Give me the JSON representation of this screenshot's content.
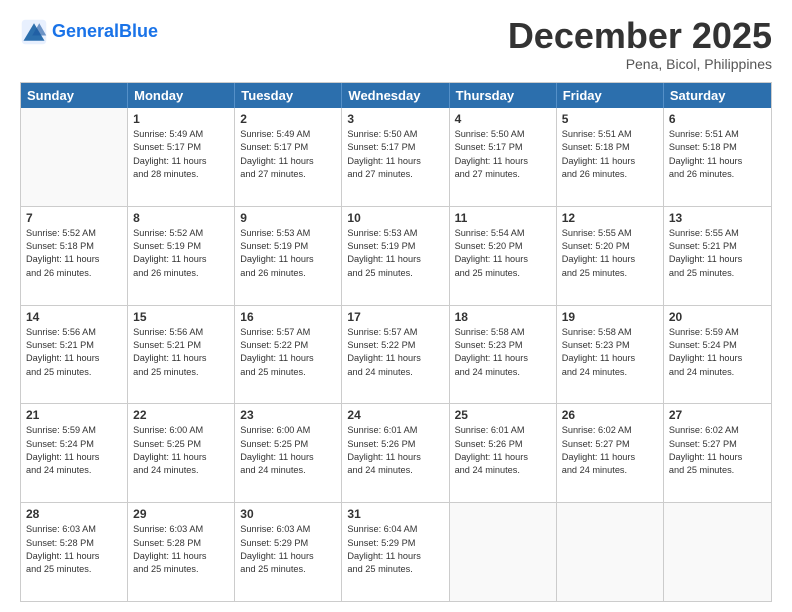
{
  "header": {
    "logo_general": "General",
    "logo_blue": "Blue",
    "month_title": "December 2025",
    "location": "Pena, Bicol, Philippines"
  },
  "day_headers": [
    "Sunday",
    "Monday",
    "Tuesday",
    "Wednesday",
    "Thursday",
    "Friday",
    "Saturday"
  ],
  "weeks": [
    [
      {
        "num": "",
        "info": ""
      },
      {
        "num": "1",
        "info": "Sunrise: 5:49 AM\nSunset: 5:17 PM\nDaylight: 11 hours\nand 28 minutes."
      },
      {
        "num": "2",
        "info": "Sunrise: 5:49 AM\nSunset: 5:17 PM\nDaylight: 11 hours\nand 27 minutes."
      },
      {
        "num": "3",
        "info": "Sunrise: 5:50 AM\nSunset: 5:17 PM\nDaylight: 11 hours\nand 27 minutes."
      },
      {
        "num": "4",
        "info": "Sunrise: 5:50 AM\nSunset: 5:17 PM\nDaylight: 11 hours\nand 27 minutes."
      },
      {
        "num": "5",
        "info": "Sunrise: 5:51 AM\nSunset: 5:18 PM\nDaylight: 11 hours\nand 26 minutes."
      },
      {
        "num": "6",
        "info": "Sunrise: 5:51 AM\nSunset: 5:18 PM\nDaylight: 11 hours\nand 26 minutes."
      }
    ],
    [
      {
        "num": "7",
        "info": "Sunrise: 5:52 AM\nSunset: 5:18 PM\nDaylight: 11 hours\nand 26 minutes."
      },
      {
        "num": "8",
        "info": "Sunrise: 5:52 AM\nSunset: 5:19 PM\nDaylight: 11 hours\nand 26 minutes."
      },
      {
        "num": "9",
        "info": "Sunrise: 5:53 AM\nSunset: 5:19 PM\nDaylight: 11 hours\nand 26 minutes."
      },
      {
        "num": "10",
        "info": "Sunrise: 5:53 AM\nSunset: 5:19 PM\nDaylight: 11 hours\nand 25 minutes."
      },
      {
        "num": "11",
        "info": "Sunrise: 5:54 AM\nSunset: 5:20 PM\nDaylight: 11 hours\nand 25 minutes."
      },
      {
        "num": "12",
        "info": "Sunrise: 5:55 AM\nSunset: 5:20 PM\nDaylight: 11 hours\nand 25 minutes."
      },
      {
        "num": "13",
        "info": "Sunrise: 5:55 AM\nSunset: 5:21 PM\nDaylight: 11 hours\nand 25 minutes."
      }
    ],
    [
      {
        "num": "14",
        "info": "Sunrise: 5:56 AM\nSunset: 5:21 PM\nDaylight: 11 hours\nand 25 minutes."
      },
      {
        "num": "15",
        "info": "Sunrise: 5:56 AM\nSunset: 5:21 PM\nDaylight: 11 hours\nand 25 minutes."
      },
      {
        "num": "16",
        "info": "Sunrise: 5:57 AM\nSunset: 5:22 PM\nDaylight: 11 hours\nand 25 minutes."
      },
      {
        "num": "17",
        "info": "Sunrise: 5:57 AM\nSunset: 5:22 PM\nDaylight: 11 hours\nand 24 minutes."
      },
      {
        "num": "18",
        "info": "Sunrise: 5:58 AM\nSunset: 5:23 PM\nDaylight: 11 hours\nand 24 minutes."
      },
      {
        "num": "19",
        "info": "Sunrise: 5:58 AM\nSunset: 5:23 PM\nDaylight: 11 hours\nand 24 minutes."
      },
      {
        "num": "20",
        "info": "Sunrise: 5:59 AM\nSunset: 5:24 PM\nDaylight: 11 hours\nand 24 minutes."
      }
    ],
    [
      {
        "num": "21",
        "info": "Sunrise: 5:59 AM\nSunset: 5:24 PM\nDaylight: 11 hours\nand 24 minutes."
      },
      {
        "num": "22",
        "info": "Sunrise: 6:00 AM\nSunset: 5:25 PM\nDaylight: 11 hours\nand 24 minutes."
      },
      {
        "num": "23",
        "info": "Sunrise: 6:00 AM\nSunset: 5:25 PM\nDaylight: 11 hours\nand 24 minutes."
      },
      {
        "num": "24",
        "info": "Sunrise: 6:01 AM\nSunset: 5:26 PM\nDaylight: 11 hours\nand 24 minutes."
      },
      {
        "num": "25",
        "info": "Sunrise: 6:01 AM\nSunset: 5:26 PM\nDaylight: 11 hours\nand 24 minutes."
      },
      {
        "num": "26",
        "info": "Sunrise: 6:02 AM\nSunset: 5:27 PM\nDaylight: 11 hours\nand 24 minutes."
      },
      {
        "num": "27",
        "info": "Sunrise: 6:02 AM\nSunset: 5:27 PM\nDaylight: 11 hours\nand 25 minutes."
      }
    ],
    [
      {
        "num": "28",
        "info": "Sunrise: 6:03 AM\nSunset: 5:28 PM\nDaylight: 11 hours\nand 25 minutes."
      },
      {
        "num": "29",
        "info": "Sunrise: 6:03 AM\nSunset: 5:28 PM\nDaylight: 11 hours\nand 25 minutes."
      },
      {
        "num": "30",
        "info": "Sunrise: 6:03 AM\nSunset: 5:29 PM\nDaylight: 11 hours\nand 25 minutes."
      },
      {
        "num": "31",
        "info": "Sunrise: 6:04 AM\nSunset: 5:29 PM\nDaylight: 11 hours\nand 25 minutes."
      },
      {
        "num": "",
        "info": ""
      },
      {
        "num": "",
        "info": ""
      },
      {
        "num": "",
        "info": ""
      }
    ]
  ]
}
